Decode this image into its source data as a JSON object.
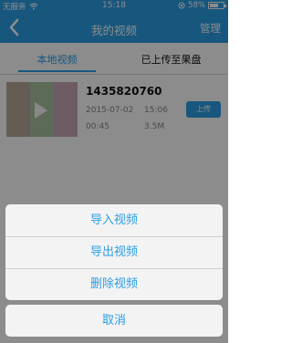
{
  "status_bar": {
    "carrier": "无服务",
    "time": "15:18",
    "battery": "58%",
    "battery_level": 0.58
  },
  "nav": {
    "title": "我的视频",
    "right_label": "管理"
  },
  "tabs": [
    {
      "label": "本地视频",
      "active": true
    },
    {
      "label": "已上传至果盘",
      "active": false
    }
  ],
  "video": {
    "name": "1435820760",
    "date": "2015-07-02",
    "time": "15:06",
    "duration": "00:45",
    "size": "3.5M",
    "upload_label": "上传"
  },
  "action_sheet": {
    "items": [
      "导入视频",
      "导出视频",
      "删除视频"
    ],
    "cancel_label": "取消"
  },
  "colors": {
    "accent": "#2b9ee6"
  }
}
